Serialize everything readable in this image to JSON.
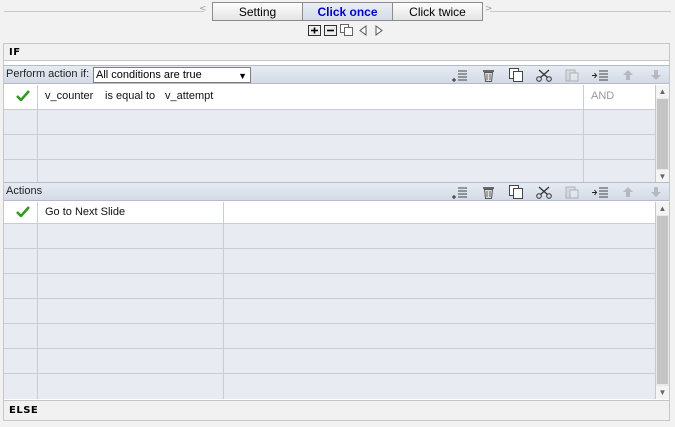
{
  "tabs": [
    {
      "label": "Setting",
      "active": false
    },
    {
      "label": "Click once",
      "active": true
    },
    {
      "label": "Click twice",
      "active": false
    }
  ],
  "nav_icons": [
    "add-icon",
    "remove-icon",
    "copy-icon",
    "prev-icon",
    "next-icon"
  ],
  "if_section": {
    "header": "IF",
    "toolbar": {
      "label": "Perform action if:",
      "dropdown_value": "All conditions are true",
      "icons": [
        "insert-row-icon",
        "delete-icon",
        "copy-icon",
        "cut-icon",
        "paste-icon",
        "indent-icon",
        "move-up-icon",
        "move-down-icon"
      ]
    },
    "conditions": [
      {
        "checked": true,
        "variable": "v_counter",
        "operator": "is equal to",
        "value": "v_attempt",
        "logic": "AND"
      },
      {
        "checked": false,
        "variable": "",
        "operator": "",
        "value": "",
        "logic": ""
      },
      {
        "checked": false,
        "variable": "",
        "operator": "",
        "value": "",
        "logic": ""
      },
      {
        "checked": false,
        "variable": "",
        "operator": "",
        "value": "",
        "logic": ""
      }
    ]
  },
  "actions_section": {
    "toolbar": {
      "label": "Actions",
      "icons": [
        "insert-row-icon",
        "delete-icon",
        "copy-icon",
        "cut-icon",
        "paste-icon",
        "indent-icon",
        "move-up-icon",
        "move-down-icon"
      ]
    },
    "actions": [
      {
        "checked": true,
        "action": "Go to Next Slide",
        "target": ""
      },
      {
        "checked": false,
        "action": "",
        "target": ""
      },
      {
        "checked": false,
        "action": "",
        "target": ""
      },
      {
        "checked": false,
        "action": "",
        "target": ""
      },
      {
        "checked": false,
        "action": "",
        "target": ""
      },
      {
        "checked": false,
        "action": "",
        "target": ""
      },
      {
        "checked": false,
        "action": "",
        "target": ""
      },
      {
        "checked": false,
        "action": "",
        "target": ""
      }
    ]
  },
  "else_section": {
    "header": "ELSE"
  },
  "colors": {
    "active_tab_text": "#0000c8",
    "check": "#2e9a1e",
    "toolbar_bg": "#dde2ec",
    "row_bg": "#e8ebf2"
  }
}
